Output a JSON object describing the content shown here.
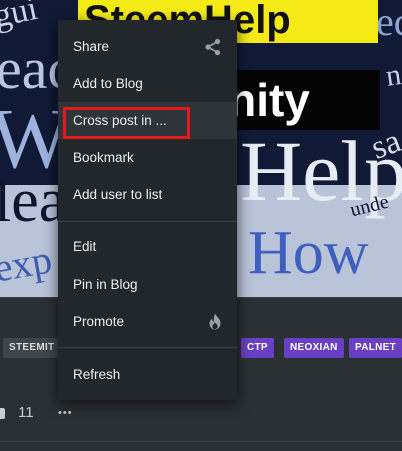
{
  "post_image": {
    "banner_top": "SteemHelp",
    "banner_bottom": "unity",
    "words": [
      "gui",
      "eac",
      "W",
      "lea",
      "exp",
      "Help",
      "How",
      "unde",
      "sa",
      "ec",
      "ne"
    ]
  },
  "menu": {
    "items": [
      {
        "label": "Share",
        "icon": "share-icon"
      },
      {
        "label": "Add to Blog"
      },
      {
        "label": "Cross post in ..."
      },
      {
        "label": "Bookmark"
      },
      {
        "label": "Add user to list"
      },
      {
        "label": "Edit"
      },
      {
        "label": "Pin in Blog"
      },
      {
        "label": "Promote",
        "icon": "flame-icon"
      },
      {
        "label": "Refresh"
      }
    ]
  },
  "tags": [
    "STEEMIT",
    "CTP",
    "NEOXIAN",
    "PALNET"
  ],
  "footer": {
    "comment_count": "11",
    "more": "•••"
  },
  "colors": {
    "menu_bg": "#22272b",
    "highlight": "#e5191c",
    "tag_purple": "#6a3fc3",
    "tag_grey": "#3f464b",
    "banner_yellow": "#f5ea15"
  }
}
